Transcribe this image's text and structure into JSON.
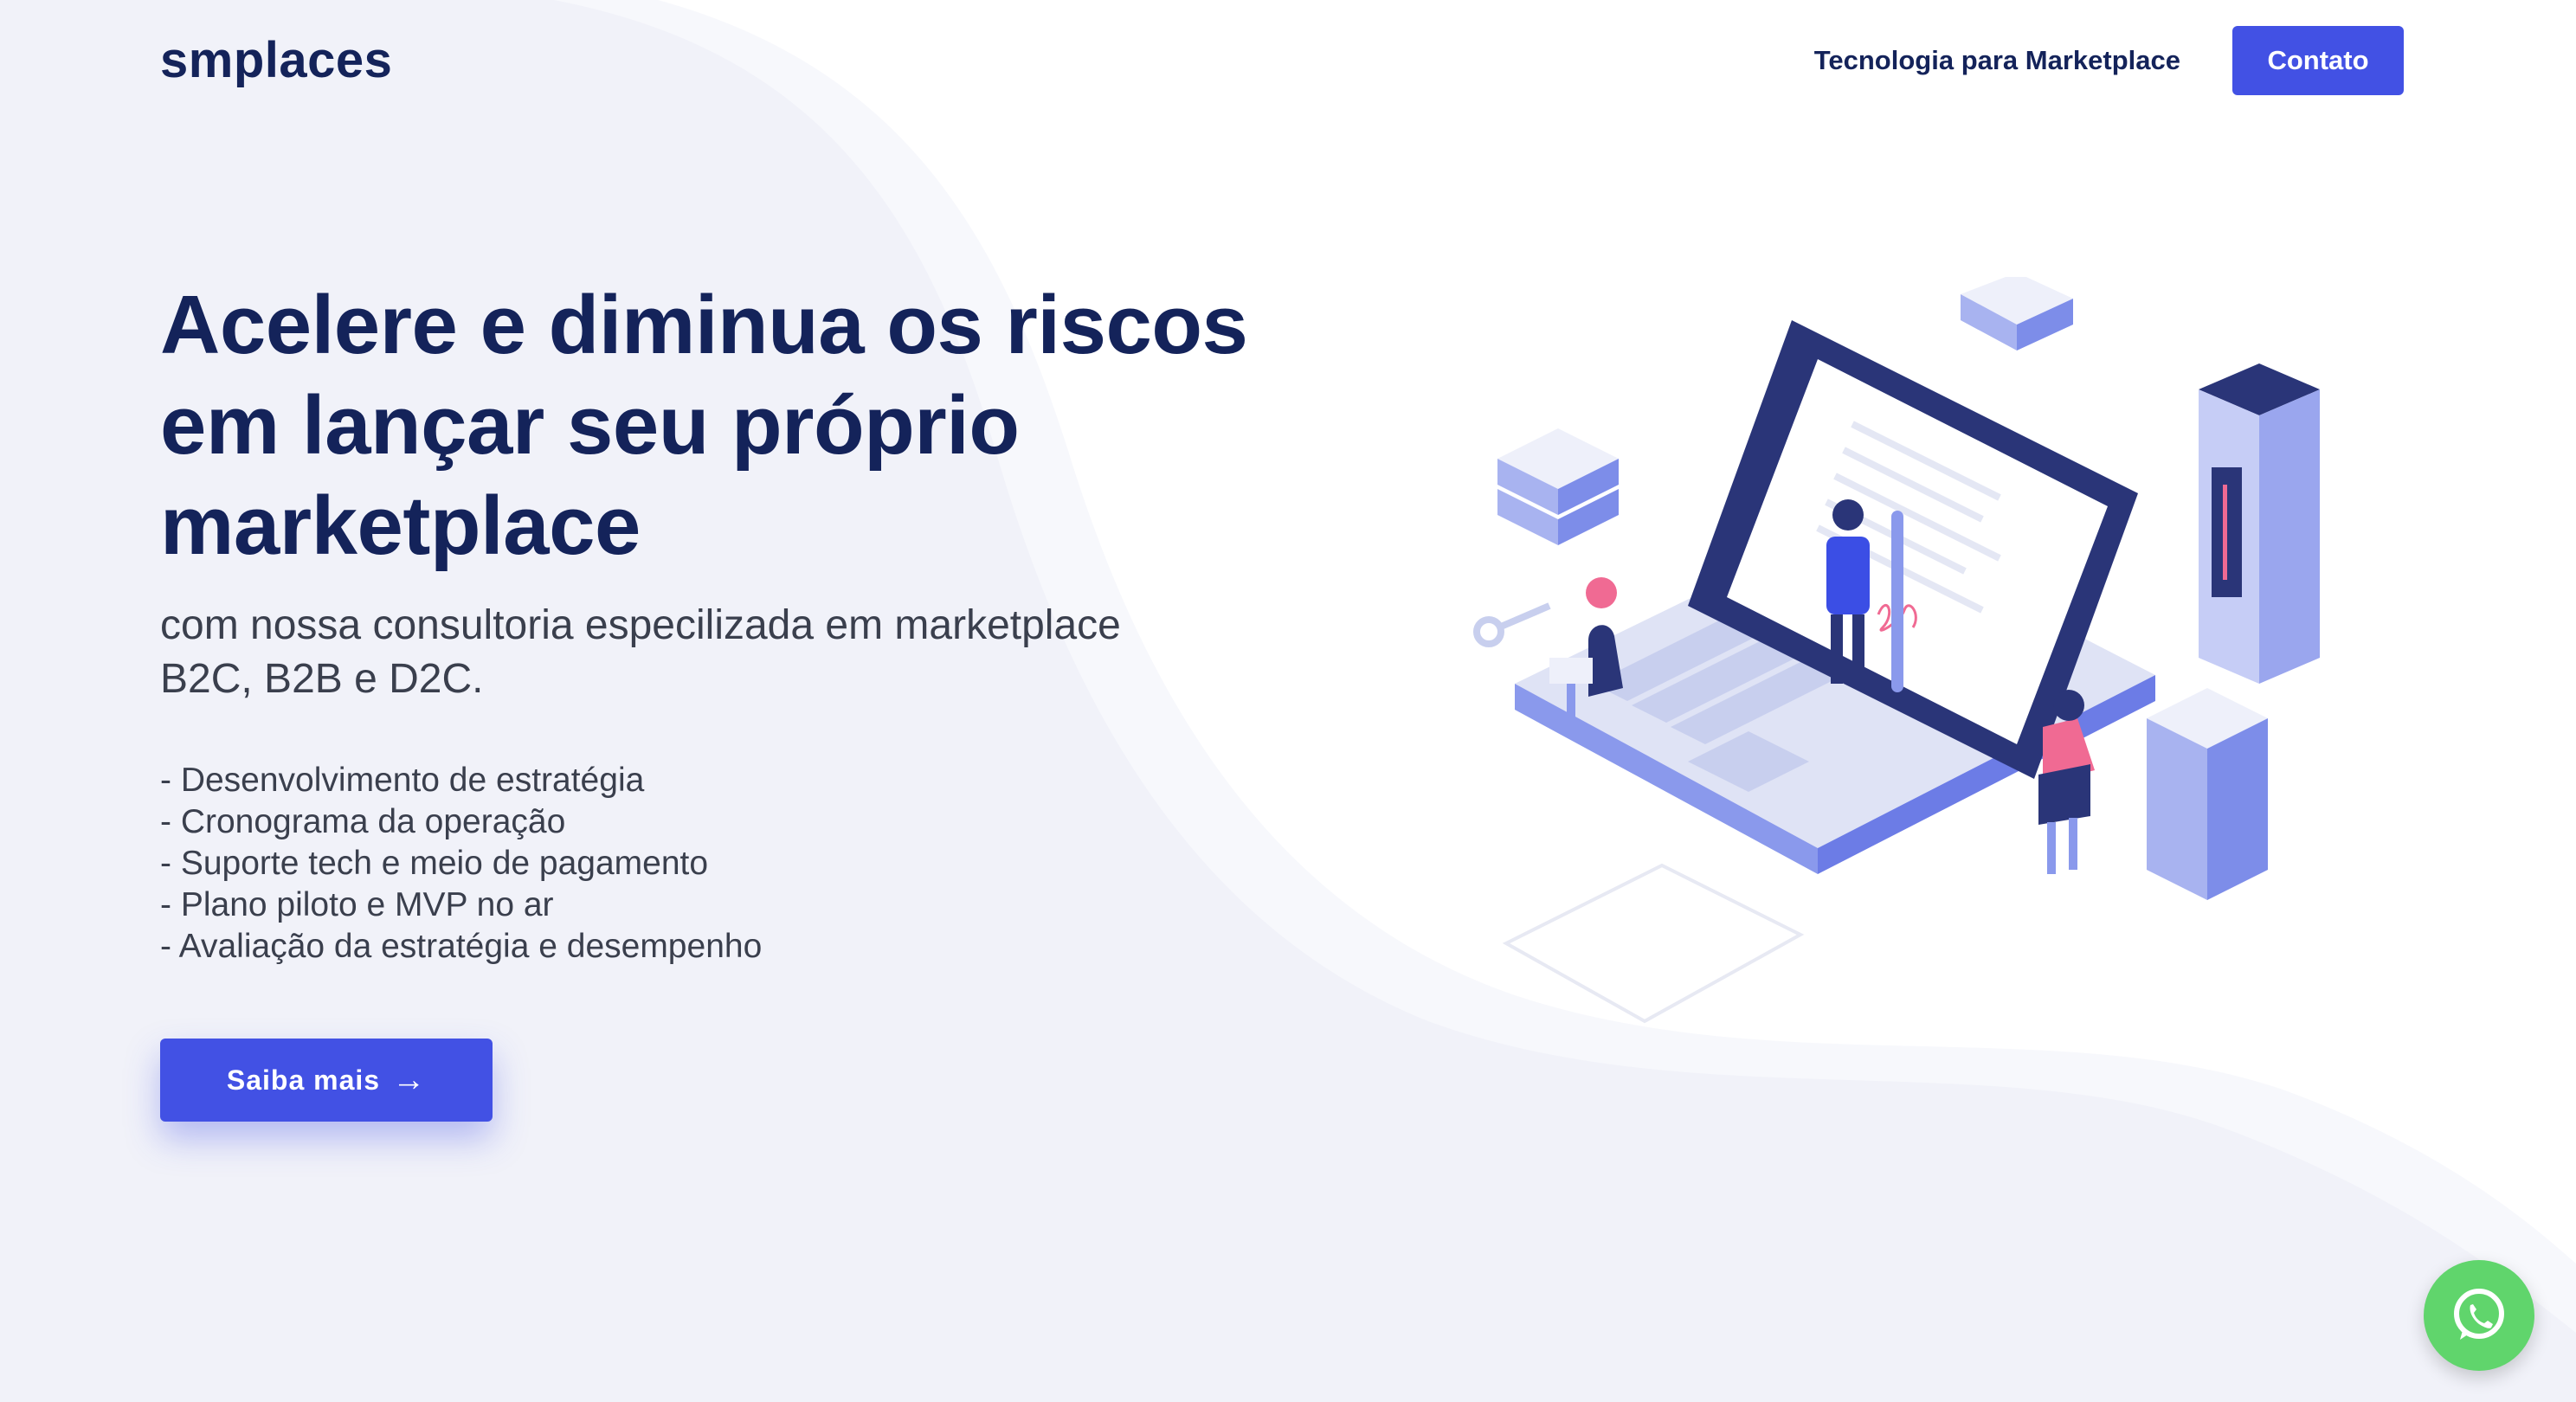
{
  "header": {
    "logo": "smplaces",
    "nav_link": "Tecnologia para Marketplace",
    "contact_button": "Contato"
  },
  "hero": {
    "title_lines": [
      "Acelere e diminua os riscos",
      "em lançar seu próprio",
      "marketplace"
    ],
    "subtitle_lines": [
      "com nossa consultoria especilizada em marketplace",
      "B2C, B2B e D2C."
    ],
    "features": [
      "- Desenvolvimento de estratégia",
      "- Cronograma da operação",
      "- Suporte tech e meio de pagamento",
      "- Plano piloto e MVP no ar",
      "- Avaliação da estratégia e desempenho"
    ],
    "cta_label": "Saiba mais",
    "cta_icon": "arrow-right-icon"
  },
  "illustration": {
    "icon": "isometric-laptop-illustration"
  },
  "floating": {
    "whatsapp_icon": "whatsapp-icon"
  },
  "colors": {
    "brand_dark": "#14235a",
    "accent": "#4251e4",
    "background": "#f1f2f9",
    "whatsapp": "#60d56c"
  }
}
